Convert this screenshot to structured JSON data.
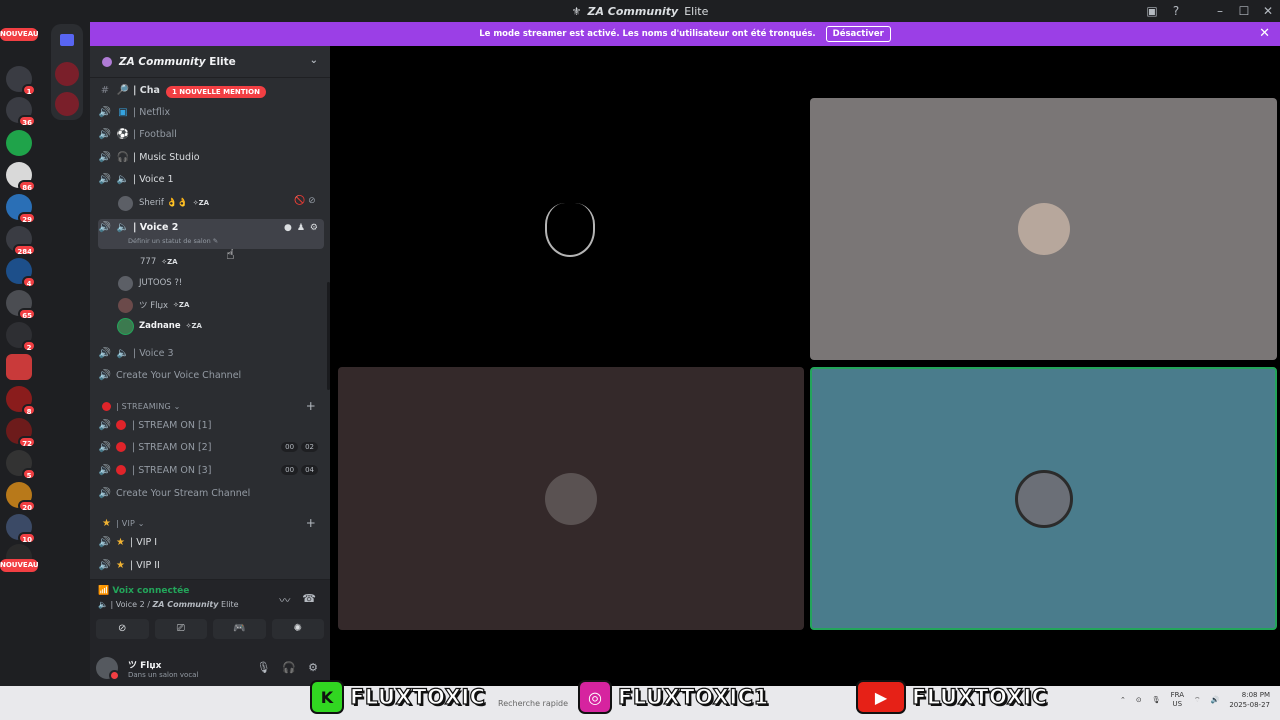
{
  "window": {
    "title_italic": "ZA Community",
    "title_rest": " Elite",
    "controls": [
      "–",
      "☐",
      "✕"
    ]
  },
  "server_rail": {
    "new_label_top": "NOUVEAU",
    "new_label_bottom": "NOUVEAU",
    "servers": [
      {
        "badge": "1"
      },
      {
        "badge": "36"
      },
      {
        "badge": ""
      },
      {
        "badge": "86"
      },
      {
        "badge": "29"
      },
      {
        "badge": "284"
      },
      {
        "badge": "4"
      },
      {
        "badge": "65"
      },
      {
        "badge": "2"
      },
      {
        "badge": ""
      },
      {
        "badge": "8"
      },
      {
        "badge": "72"
      },
      {
        "badge": "5"
      },
      {
        "badge": "20"
      },
      {
        "badge": "10"
      }
    ]
  },
  "banner": {
    "message": "Le mode streamer est activé. Les noms d'utilisateur ont été tronqués.",
    "button": "Désactiver",
    "close": "✕"
  },
  "guild": {
    "name_italic": "ZA Community",
    "name_rest": " Elite",
    "mention_pill": "1 NOUVELLE MENTION"
  },
  "channels": {
    "chat": "| Cha",
    "netflix": "| Netflix",
    "football": "| Football",
    "music": "| Music Studio",
    "voice1": "| Voice 1",
    "voice1_users": [
      {
        "name": "Sherif 👌👌",
        "tag": "✧ZA"
      }
    ],
    "voice2": "| Voice 2",
    "voice2_status": "Définir un statut de salon ✎",
    "voice2_users": [
      {
        "name": "777",
        "tag": "✧ZA"
      },
      {
        "name": "JUTOOS ?!",
        "tag": ""
      },
      {
        "name": "ツ Flџx",
        "tag": "✧ZA"
      },
      {
        "name": "Zadnane",
        "tag": "✧ZA"
      }
    ],
    "voice3": "| Voice 3",
    "create_voice": "Create Your Voice Channel"
  },
  "streaming": {
    "category": "| STREAMING ⌄",
    "streams": [
      {
        "name": "| STREAM ON [1]",
        "pills": []
      },
      {
        "name": "| STREAM ON [2]",
        "pills": [
          "00",
          "02"
        ]
      },
      {
        "name": "| STREAM ON [3]",
        "pills": [
          "00",
          "04"
        ]
      }
    ],
    "create": "Create Your Stream Channel"
  },
  "vip": {
    "category": "| VIP ⌄",
    "channels": [
      "| VIP  I",
      "| VIP II"
    ]
  },
  "voice_panel": {
    "status": "Voix connectée",
    "channel_prefix": "| Voice 2 / ",
    "channel_italic": "ZA Community",
    "channel_rest": " Elite"
  },
  "user": {
    "name": "ツ Flџx",
    "status": "Dans un salon vocal"
  },
  "overlay": {
    "brand1": "FLUXTOXIC",
    "brand2": "FLUXTOXIC1",
    "brand3": "FLUXTOXIC",
    "search_placeholder": "Recherche rapide",
    "lang1": "FRA",
    "lang2": "US",
    "time": "8:08 PM",
    "date": "2025-08-27"
  },
  "colors": {
    "accent": "#5865f2",
    "banner": "#9b3fe6",
    "connected": "#23a55a",
    "badge": "#f23f43"
  }
}
